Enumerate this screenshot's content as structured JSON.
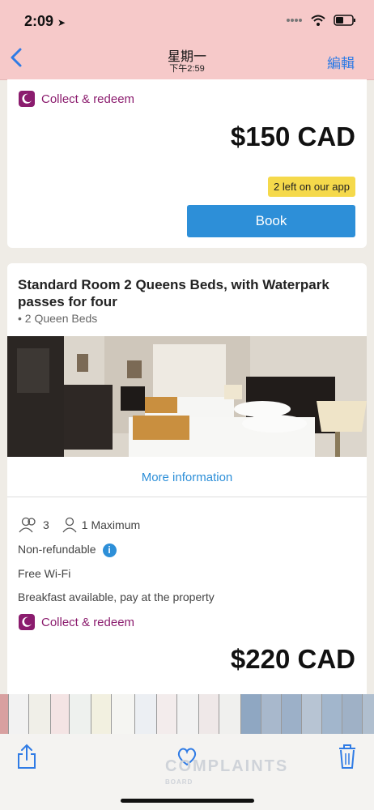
{
  "status": {
    "time": "2:09"
  },
  "nav": {
    "back_icon": "chevron-left-icon",
    "title": "星期一",
    "subtitle": "下午2:59",
    "edit_label": "編輯"
  },
  "offer1": {
    "collect_label": "Collect & redeem",
    "price": "$150 CAD",
    "badge": "2 left on our app",
    "book_label": "Book"
  },
  "room2": {
    "title": "Standard Room 2 Queens Beds, with Waterpark passes for four",
    "beds": "• 2 Queen Beds",
    "more_info": "More information",
    "guests_count": "3",
    "maximum": "1 Maximum",
    "refund": "Non-refundable",
    "wifi": "Free Wi-Fi",
    "breakfast": "Breakfast available, pay at the property",
    "collect_label": "Collect & redeem",
    "price": "$220 CAD"
  },
  "watermark": {
    "main": "COMPLAINTS",
    "sub": "BOARD"
  },
  "colors": {
    "accent": "#2d8fd8",
    "brand": "#8b1c6e",
    "header": "#f6c9c9",
    "badge": "#f5d94b"
  }
}
